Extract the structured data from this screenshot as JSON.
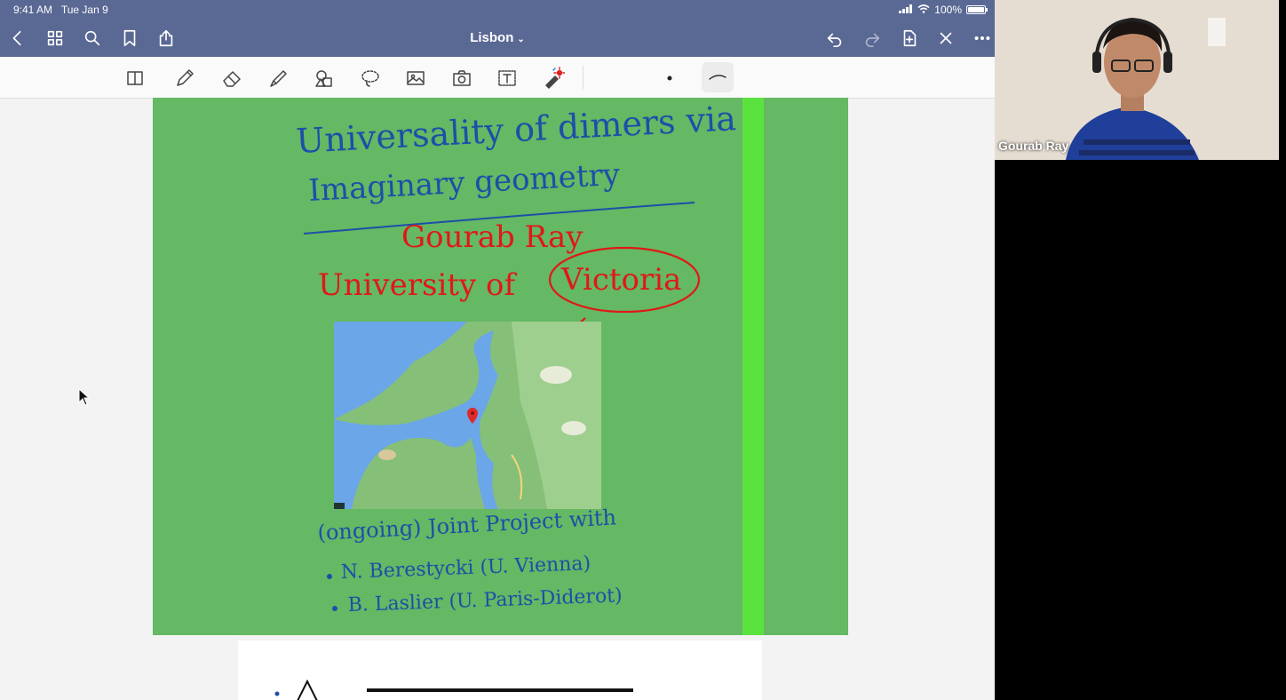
{
  "status_bar": {
    "time": "9:41 AM",
    "date": "Tue Jan 9",
    "battery": "100%"
  },
  "nav_bar": {
    "title": "Lisbon",
    "icons": [
      "back-icon",
      "grid-icon",
      "search-icon",
      "bookmark-icon",
      "share-icon",
      "undo-icon",
      "redo-icon",
      "add-page-icon",
      "close-icon",
      "more-icon"
    ]
  },
  "toolbar": {
    "tools": [
      "reader-icon",
      "pen-icon",
      "eraser-icon",
      "highlighter-icon",
      "shapes-icon",
      "lasso-icon",
      "image-icon",
      "camera-icon",
      "text-icon",
      "laser-pointer-icon",
      "stroke-dot-icon",
      "stroke-curve-icon"
    ]
  },
  "slide": {
    "title_line1": "Universality of dimers via",
    "title_line2": "Imaginary geometry",
    "author": "Gourab Ray",
    "affiliation_prefix": "University of",
    "affiliation_circled": "Victoria",
    "project_line": "(ongoing) Joint Project with",
    "collaborators": [
      "N. Berestycki (U. Vienna)",
      "B. Laslier (U. Paris-Diderot)"
    ]
  },
  "video": {
    "participant_name": "Gourab Ray"
  },
  "colors": {
    "header": "#5a6894",
    "slide_bg": "#65b864",
    "stripe": "#5ae23e",
    "ink_blue": "#1d4fa8",
    "ink_red": "#e01818"
  }
}
